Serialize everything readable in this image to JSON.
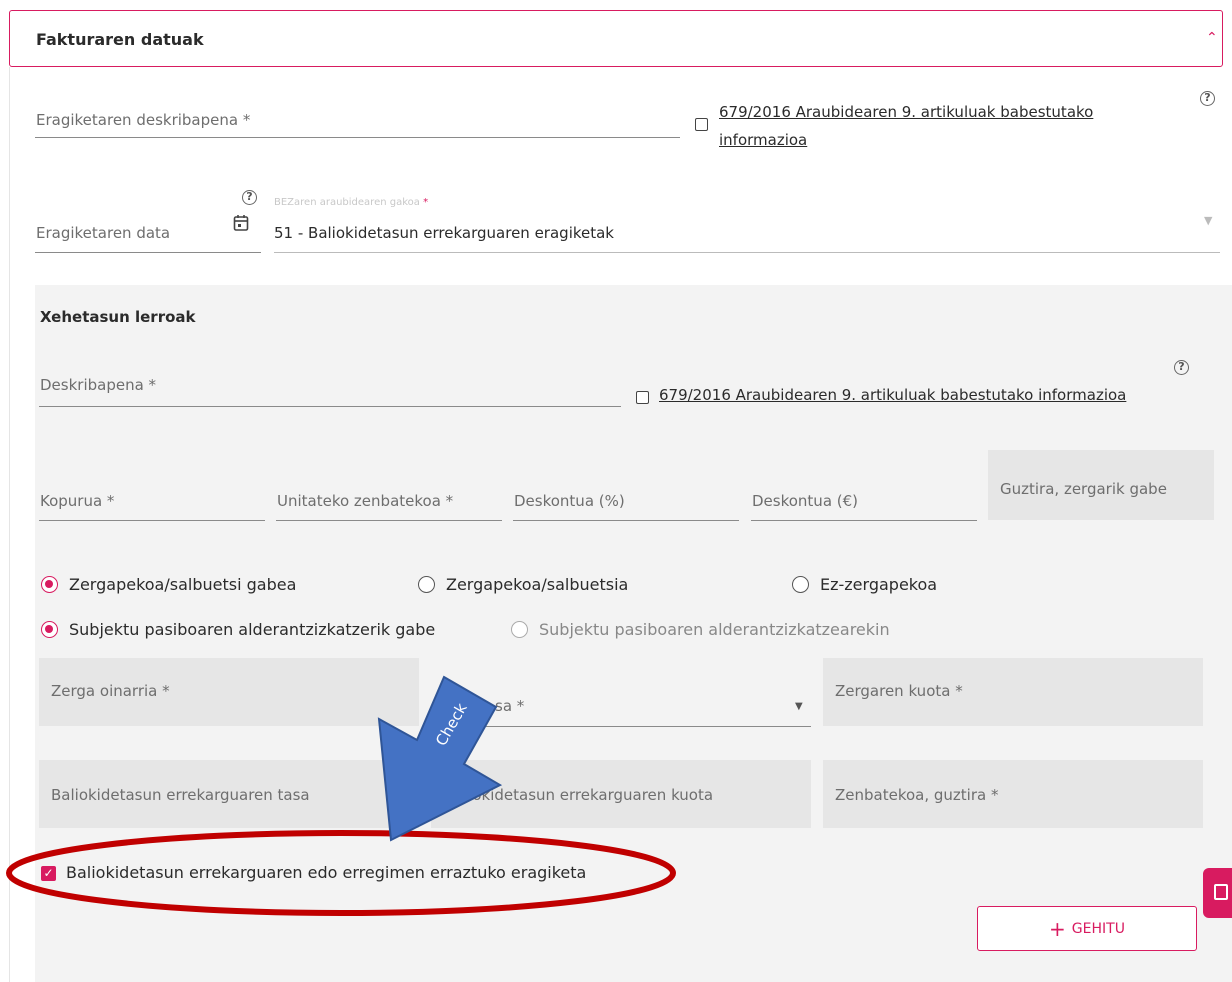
{
  "header": {
    "title": "Fakturaren datuak"
  },
  "invoice": {
    "description_label": "Eragiketaren deskribapena *",
    "gdpr_link": "679/2016 Araubidearen 9. artikuluak babestutako informazioa",
    "gdpr_link_line1": "679/2016 Araubidearen 9. artikuluak babestutako",
    "gdpr_link_line2": "informazioa",
    "date_label": "Eragiketaren data",
    "vat_regime_label": "BEZaren araubidearen gakoa",
    "vat_regime_required": "*",
    "vat_regime_value": "51 - Baliokidetasun errekarguaren eragiketak"
  },
  "detail": {
    "title": "Xehetasun lerroak",
    "description_label": "Deskribapena *",
    "gdpr_link": "679/2016 Araubidearen 9. artikuluak babestutako informazioa",
    "quantity_label": "Kopurua *",
    "unit_amount_label": "Unitateko zenbatekoa *",
    "discount_pct_label": "Deskontua (%)",
    "discount_eur_label": "Deskontua (€)",
    "total_no_tax_label": "Guztira, zergarik gabe",
    "radio_tax": {
      "option1": "Zergapekoa/salbuetsi gabea",
      "option2": "Zergapekoa/salbuetsia",
      "option3": "Ez-zergapekoa",
      "selected": "Zergapekoa/salbuetsi gabea"
    },
    "radio_passive": {
      "option1": "Subjektu pasiboaren alderantzizkatzerik gabe",
      "option2": "Subjektu pasiboaren alderantzizkatzearekin",
      "selected": "Subjektu pasiboaren alderantzizkatzerik gabe"
    },
    "tax_base_label": "Zerga oinarria *",
    "tax_rate_label": "Zerga tasa *",
    "tax_rate_label_visible": "sa *",
    "tax_quota_label": "Zergaren kuota *",
    "surcharge_rate_label": "Baliokidetasun errekarguaren tasa",
    "surcharge_quota_label": "Baliokidetasun errekarguaren kuota",
    "surcharge_quota_label_visible": "liokidetasun errekarguaren kuota",
    "total_label": "Zenbatekoa, guztira *",
    "surcharge_checkbox_label": "Baliokidetasun errekarguaren edo erregimen erraztuko eragiketa",
    "surcharge_checkbox_checked": true,
    "add_button": "GEHITU"
  },
  "annotation": {
    "arrow_text": "Check"
  },
  "colors": {
    "accent": "#d81b60",
    "annotation_arrow": "#4472c4",
    "annotation_ellipse": "#c00000"
  }
}
